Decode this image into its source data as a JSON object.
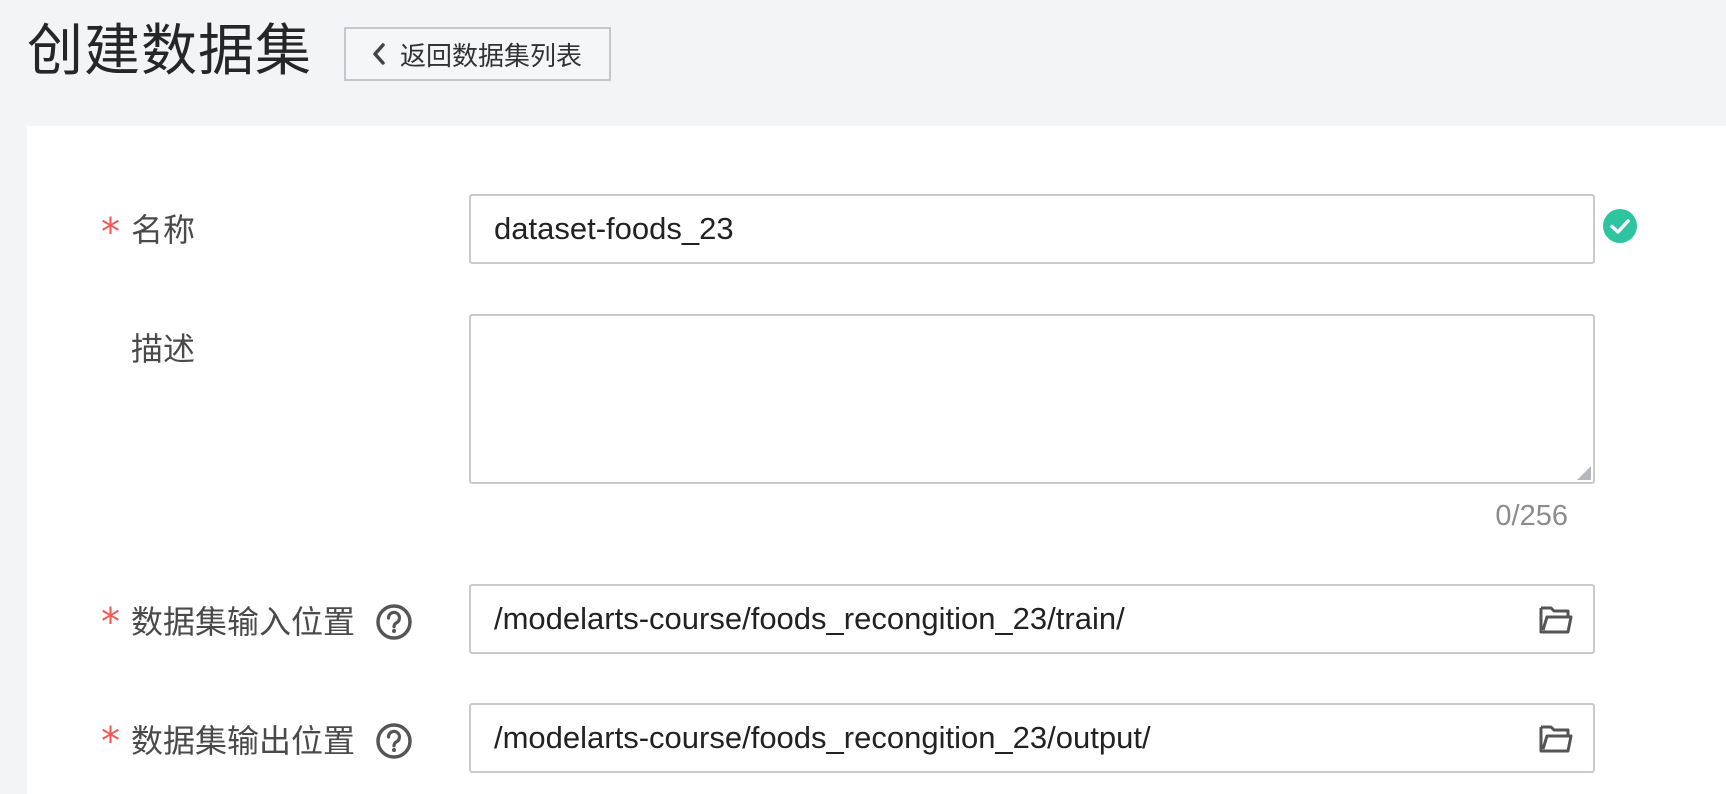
{
  "header": {
    "title": "创建数据集",
    "back_label": "返回数据集列表"
  },
  "form": {
    "name": {
      "label": "名称",
      "required": "*",
      "value": "dataset-foods_23"
    },
    "description": {
      "label": "描述",
      "value": "",
      "counter": "0/256"
    },
    "input_location": {
      "label": "数据集输入位置",
      "required": "*",
      "value": "/modelarts-course/foods_recongition_23/train/"
    },
    "output_location": {
      "label": "数据集输出位置",
      "required": "*",
      "value": "/modelarts-course/foods_recongition_23/output/"
    }
  },
  "icons": {
    "back": "chevron-left-icon",
    "valid": "check-circle-icon",
    "help": "question-circle-icon",
    "folder": "folder-open-icon"
  },
  "colors": {
    "required": "#f25757",
    "valid": "#2ec4a0",
    "border": "#c8cacd",
    "background": "#f3f4f6"
  }
}
